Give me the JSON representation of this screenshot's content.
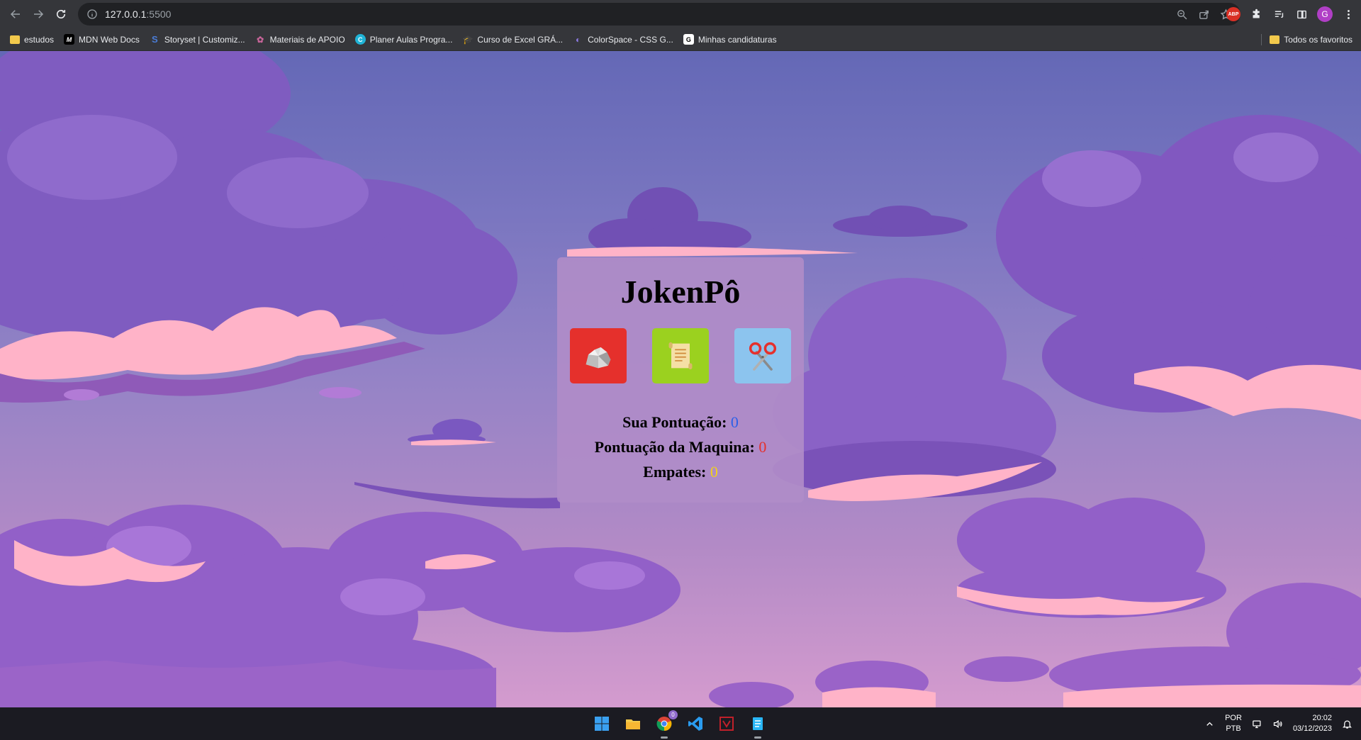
{
  "browser": {
    "url_host": "127.0.0.1",
    "url_port": ":5500",
    "profile_initial": "G",
    "abp_label": "ABP"
  },
  "bookmarks": {
    "items": [
      {
        "label": "estudos",
        "icon": "folder-icon"
      },
      {
        "label": "MDN Web Docs",
        "icon": "mdn-icon"
      },
      {
        "label": "Storyset | Customiz...",
        "icon": "storyset-icon"
      },
      {
        "label": "Materiais de APOIO",
        "icon": "materials-icon"
      },
      {
        "label": "Planer Aulas Progra...",
        "icon": "canva-icon"
      },
      {
        "label": "Curso de Excel GRÁ...",
        "icon": "graduation-cap-icon"
      },
      {
        "label": "ColorSpace - CSS G...",
        "icon": "colorspace-icon"
      },
      {
        "label": "Minhas candidaturas",
        "icon": "candidaturas-icon"
      }
    ],
    "all_bookmarks_label": "Todos os favoritos"
  },
  "game": {
    "title": "JokenPô",
    "choices": [
      {
        "name": "pedra",
        "icon": "rock-icon",
        "color": "#e5302c"
      },
      {
        "name": "papel",
        "icon": "paper-scroll-icon",
        "color": "#9bd11f"
      },
      {
        "name": "tesoura",
        "icon": "scissors-icon",
        "color": "#8cc4ee"
      }
    ],
    "scores": {
      "player_label": "Sua Pontuação:",
      "player_value": "0",
      "machine_label": "Pontuação da Maquina:",
      "machine_value": "0",
      "draws_label": "Empates:",
      "draws_value": "0"
    }
  },
  "taskbar": {
    "apps": [
      "windows-start-icon",
      "file-explorer-icon",
      "chrome-icon",
      "vscode-icon",
      "app-icon",
      "notepad-icon"
    ],
    "chrome_badge": "0",
    "lang_top": "POR",
    "lang_bottom": "PTB",
    "time": "20:02",
    "date": "03/12/2023"
  }
}
